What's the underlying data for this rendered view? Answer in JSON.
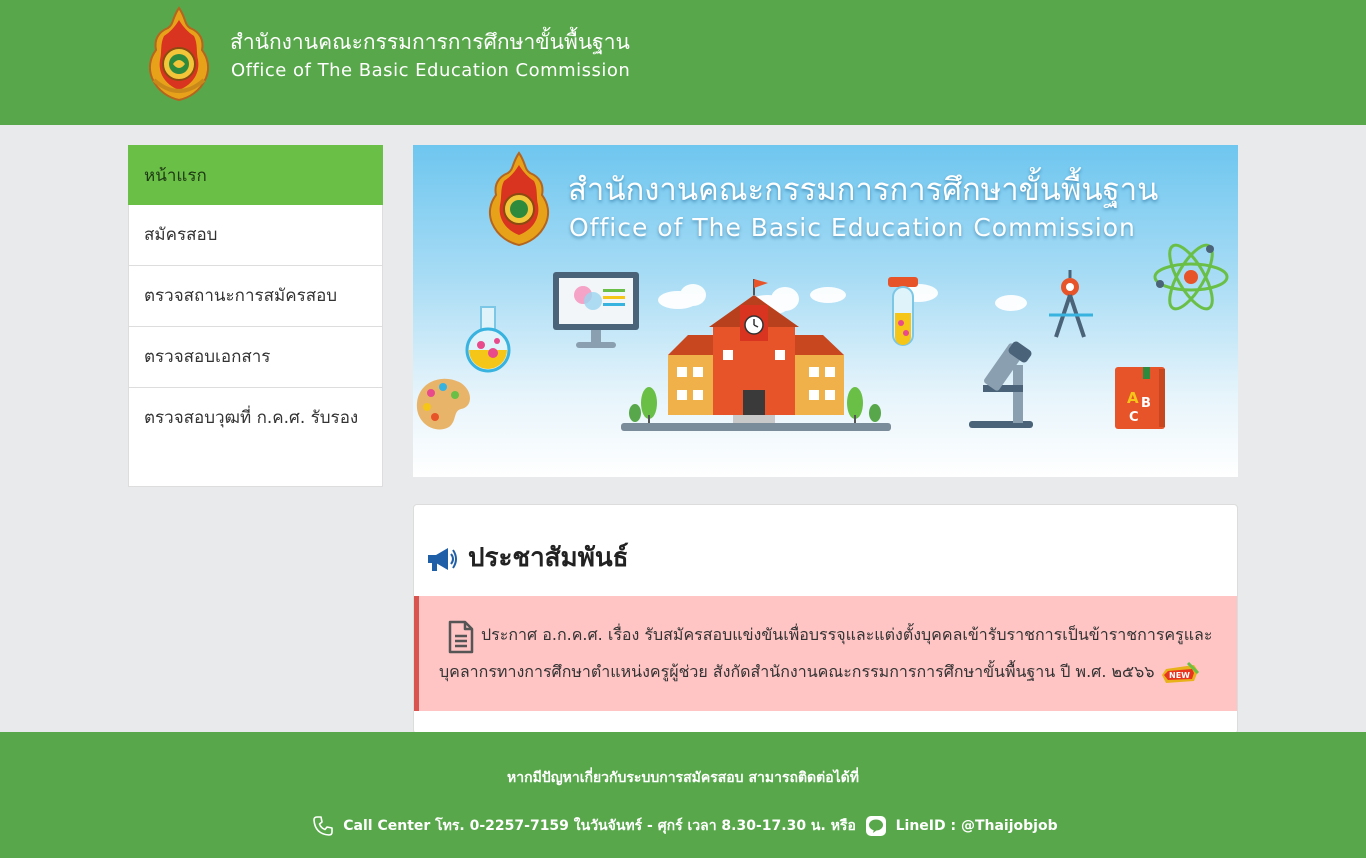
{
  "header": {
    "title": "สำนักงานคณะกรรมการการศึกษาขั้นพื้นฐาน",
    "subtitle": "Office of The Basic Education Commission"
  },
  "menu": {
    "items": [
      {
        "label": "หน้าแรก",
        "active": true
      },
      {
        "label": "สมัครสอบ",
        "active": false
      },
      {
        "label": "ตรวจสถานะการสมัครสอบ",
        "active": false
      },
      {
        "label": "ตรวจสอบเอกสาร",
        "active": false
      },
      {
        "label": "ตรวจสอบวุฒที่ ก.ค.ศ. รับรอง",
        "active": false
      }
    ]
  },
  "banner": {
    "title": "สำนักงานคณะกรรมการการศึกษาขั้นพื้นฐาน",
    "subtitle": "Office of The Basic Education Commission"
  },
  "news": {
    "heading": "ประชาสัมพันธ์",
    "announcement": "ประกาศ อ.ก.ค.ศ. เรื่อง รับสมัครสอบแข่งขันเพื่อบรรจุและแต่งตั้งบุคคลเข้ารับราชการเป็นข้าราชการครูและบุคลากรทางการศึกษาตำแหน่งครูผู้ช่วย สังกัดสำนักงานคณะกรรมการการศึกษาขั้นพื้นฐาน ปี พ.ศ. ๒๕๖๖",
    "badge": "NEW"
  },
  "footer": {
    "note": "หากมีปัญหาเกี่ยวกับระบบการสมัครสอบ สามารถติดต่อได้ที่",
    "call_center": "Call Center โทร. 0-2257-7159 ในวันจันทร์ - ศุกร์ เวลา 8.30-17.30 น. หรือ",
    "line_id": "LineID : @Thaijobjob"
  },
  "colors": {
    "header_green": "#58a84b",
    "menu_active": "#6abf46",
    "alert_bg": "#ffc5c5",
    "alert_border": "#d9534f"
  },
  "icons": [
    "obec-emblem-icon",
    "megaphone-icon",
    "document-icon",
    "new-badge-icon",
    "phone-icon",
    "line-app-icon"
  ]
}
